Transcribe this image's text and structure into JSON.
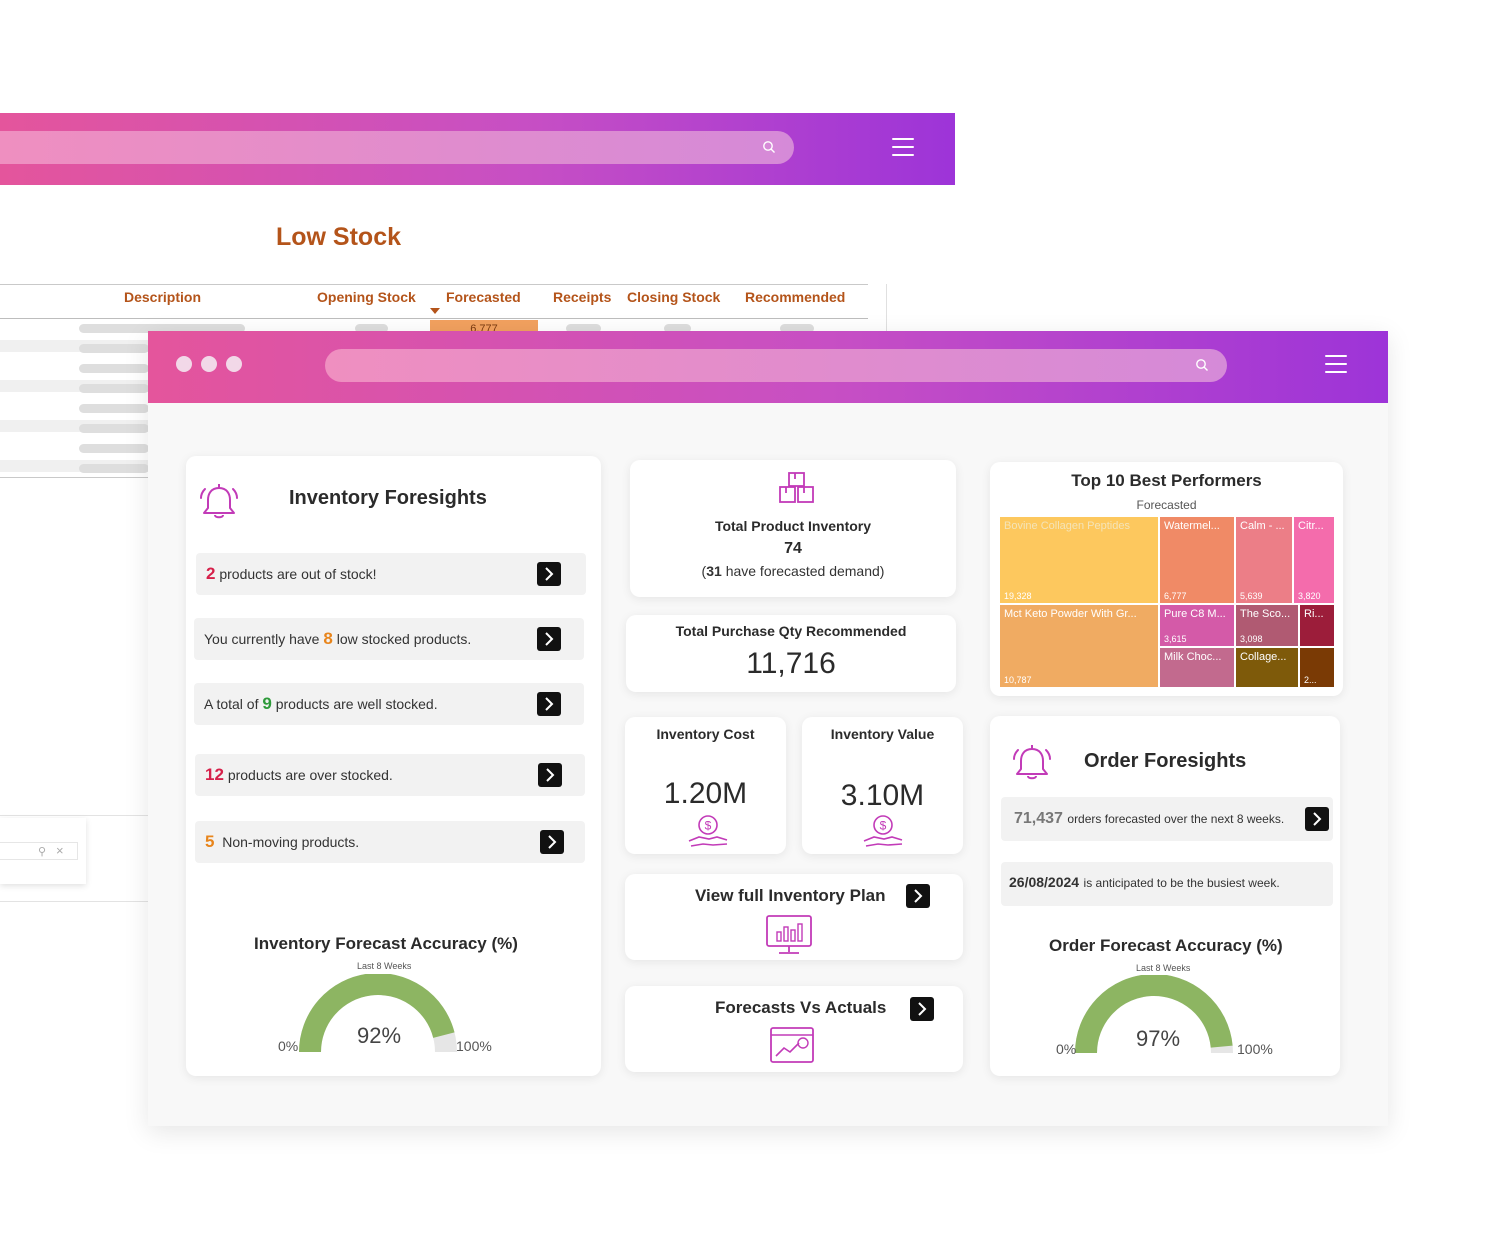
{
  "back_window": {
    "title": "Low Stock",
    "columns": [
      "Description",
      "Opening Stock",
      "Forecasted",
      "Receipts",
      "Closing Stock",
      "Recommended"
    ],
    "forecasted_first_value": "6,777",
    "search_icon": "search-icon",
    "menu_icon": "hamburger-menu-icon"
  },
  "front_window": {
    "search_icon": "search-icon",
    "menu_icon": "hamburger-menu-icon"
  },
  "inventory_foresights": {
    "title": "Inventory Foresights",
    "icon": "bell-icon",
    "rows": [
      {
        "num": "2",
        "text": "products are out of stock!",
        "pre": ""
      },
      {
        "num": "8",
        "text": "low stocked products.",
        "pre": "You currently have"
      },
      {
        "num": "9",
        "text": "products are well stocked.",
        "pre": "A total of"
      },
      {
        "num": "12",
        "text": "products are over stocked.",
        "pre": ""
      },
      {
        "num": "5",
        "text": "Non-moving products.",
        "pre": ""
      }
    ],
    "accuracy": {
      "title": "Inventory Forecast Accuracy (%)",
      "subtitle": "Last 8 Weeks",
      "value": "92%",
      "fraction": 0.92,
      "min_label": "0%",
      "max_label": "100%"
    }
  },
  "total_inventory": {
    "label": "Total Product Inventory",
    "value": "74",
    "demand_count": "31",
    "demand_text": "have forecasted demand)",
    "open_paren": "(",
    "icon": "boxes-icon"
  },
  "purchase_qty": {
    "label": "Total Purchase Qty Recommended",
    "value": "11,716"
  },
  "inventory_cost": {
    "label": "Inventory Cost",
    "value": "1.20M",
    "icon": "money-hand-icon"
  },
  "inventory_value": {
    "label": "Inventory Value",
    "value": "3.10M",
    "icon": "money-hand-icon"
  },
  "inventory_plan": {
    "label": "View full Inventory Plan",
    "icon": "monitor-chart-icon"
  },
  "forecasts_vs_actuals": {
    "label": "Forecasts Vs Actuals",
    "icon": "trend-chart-icon"
  },
  "top_performers": {
    "title": "Top 10 Best Performers",
    "subtitle": "Forecasted"
  },
  "chart_data": {
    "type": "treemap",
    "title": "Top 10 Best Performers",
    "subtitle": "Forecasted",
    "items": [
      {
        "name": "Bovine Collagen Peptides",
        "label": "Bovine Collagen Peptides",
        "value": 19328,
        "value_label": "19,328",
        "color": "#fdc85e"
      },
      {
        "name": "Mct Keto Powder With Gr...",
        "label": "Mct Keto Powder With Gr...",
        "value": 10787,
        "value_label": "10,787",
        "color": "#f0ab62"
      },
      {
        "name": "Watermel...",
        "label": "Watermel...",
        "value": 6777,
        "value_label": "6,777",
        "color": "#f08a66"
      },
      {
        "name": "Calm - ...",
        "label": "Calm - ...",
        "value": 5639,
        "value_label": "5,639",
        "color": "#ec7e87"
      },
      {
        "name": "Citr...",
        "label": "Citr...",
        "value": 3820,
        "value_label": "3,820",
        "color": "#f46cac"
      },
      {
        "name": "Pure C8 M...",
        "label": "Pure C8 M...",
        "value": 3615,
        "value_label": "3,615",
        "color": "#d45aa8"
      },
      {
        "name": "The Sco...",
        "label": "The Sco...",
        "value": 3098,
        "value_label": "3,098",
        "color": "#b05a72"
      },
      {
        "name": "Ri...",
        "label": "Ri...",
        "value": null,
        "value_label": "",
        "color": "#9c1d3a"
      },
      {
        "name": "Milk Choc...",
        "label": "Milk Choc...",
        "value": null,
        "value_label": "",
        "color": "#c26a8e"
      },
      {
        "name": "Collage...",
        "label": "Collage...",
        "value": null,
        "value_label": "",
        "color": "#7e5a0a"
      },
      {
        "name": "2...",
        "label": "",
        "value": null,
        "value_label": "2...",
        "color": "#7a3a05"
      }
    ]
  },
  "order_foresights": {
    "title": "Order Foresights",
    "icon": "bell-icon",
    "orders_num": "71,437",
    "orders_text": "orders forecasted over the next 8 weeks.",
    "busiest_date": "26/08/2024",
    "busiest_text": "is anticipated to be the busiest week.",
    "accuracy": {
      "title": "Order Forecast Accuracy (%)",
      "subtitle": "Last 8 Weeks",
      "value": "97%",
      "fraction": 0.97,
      "min_label": "0%",
      "max_label": "100%"
    }
  },
  "colors": {
    "brand_gradient_start": "#e4559c",
    "brand_gradient_end": "#9d34d8",
    "accent_magenta": "#c23bb8",
    "header_orange": "#b4541a",
    "gauge_green": "#8db562",
    "gauge_track": "#e6e6e6"
  }
}
